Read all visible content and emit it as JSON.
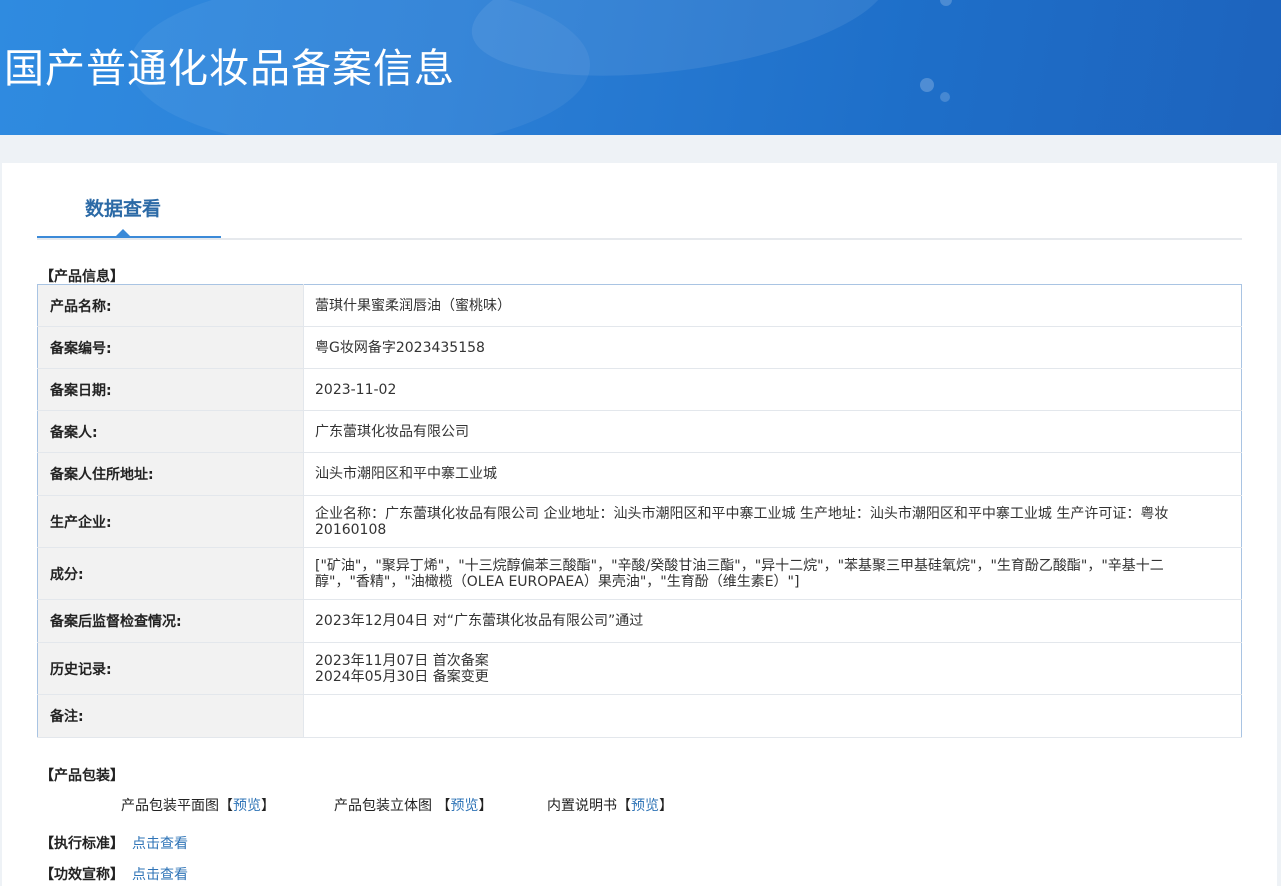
{
  "header": {
    "title": "国产普通化妆品备案信息"
  },
  "tabs": [
    {
      "label": "数据查看",
      "active": true
    }
  ],
  "product_info": {
    "section_title": "【产品信息】",
    "rows": [
      {
        "label": "产品名称:",
        "value": "蕾琪什果蜜柔润唇油（蜜桃味）"
      },
      {
        "label": "备案编号:",
        "value": "粤G妆网备字2023435158"
      },
      {
        "label": "备案日期:",
        "value": "2023-11-02"
      },
      {
        "label": "备案人:",
        "value": "广东蕾琪化妆品有限公司"
      },
      {
        "label": "备案人住所地址:",
        "value": "汕头市潮阳区和平中寨工业城"
      },
      {
        "label": "生产企业:",
        "value": "企业名称：广东蕾琪化妆品有限公司 企业地址：汕头市潮阳区和平中寨工业城 生产地址：汕头市潮阳区和平中寨工业城 生产许可证：粤妆20160108"
      },
      {
        "label": "成分:",
        "value": "[\"矿油\"，\"聚异丁烯\"，\"十三烷醇偏苯三酸酯\"，\"辛酸/癸酸甘油三酯\"，\"异十二烷\"，\"苯基聚三甲基硅氧烷\"，\"生育酚乙酸酯\"，\"辛基十二醇\"，\"香精\"，\"油橄榄（OLEA EUROPAEA）果壳油\"，\"生育酚（维生素E）\"]"
      },
      {
        "label": "备案后监督检查情况:",
        "value": "2023年12月04日 对“广东蕾琪化妆品有限公司”通过"
      },
      {
        "label": "历史记录:",
        "value": "2023年11月07日 首次备案",
        "value2": "2024年05月30日 备案变更"
      },
      {
        "label": "备注:",
        "value": ""
      }
    ]
  },
  "packaging": {
    "section_title": "【产品包装】",
    "items": [
      {
        "label": "产品包装平面图【",
        "link": "预览",
        "suffix": "】"
      },
      {
        "label": "产品包装立体图 【",
        "link": "预览",
        "suffix": "】"
      },
      {
        "label": "内置说明书【",
        "link": "预览",
        "suffix": "】"
      }
    ]
  },
  "standard": {
    "label": "【执行标准】",
    "link": "点击查看"
  },
  "efficacy": {
    "label": "【功效宣称】",
    "link": "点击查看"
  },
  "colors": {
    "banner": "#2b7fd6",
    "link": "#2f74b7",
    "tab_accent": "#3b8ad8",
    "table_border": "#a9c4e3"
  }
}
